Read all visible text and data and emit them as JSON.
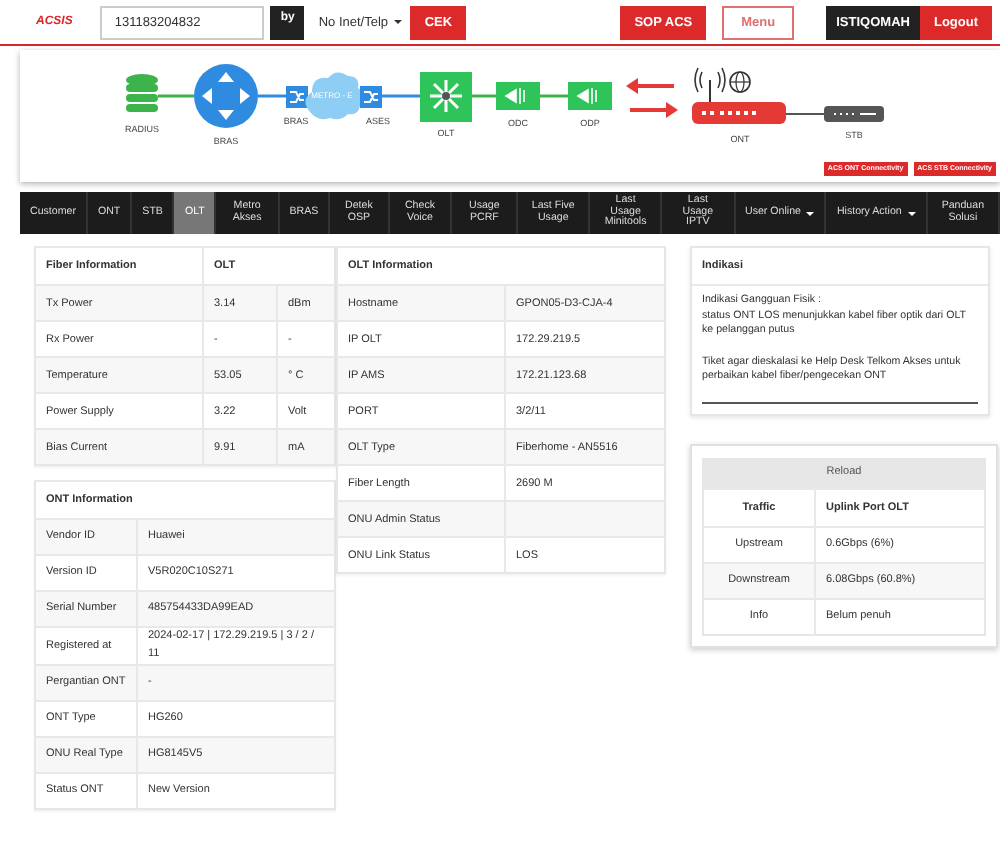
{
  "header": {
    "logo": "ACSIS",
    "search_value": "131183204832",
    "by_label": "by",
    "select_value": "No Inet/Telp",
    "check_button": "CEK",
    "sop_button": "SOP ACS",
    "menu_button": "Menu",
    "user": "ISTIQOMAH",
    "logout_button": "Logout"
  },
  "topology": {
    "nodes": [
      {
        "kind": "database",
        "label": "RADIUS"
      },
      {
        "kind": "router",
        "label": "BRAS"
      },
      {
        "kind": "metro",
        "label": "METRO - E",
        "left_label": "BRAS",
        "right_label": "ASES"
      },
      {
        "kind": "olt",
        "label": "OLT"
      },
      {
        "kind": "odc",
        "label": "ODC"
      },
      {
        "kind": "odp",
        "label": "ODP"
      },
      {
        "kind": "ont",
        "label": "ONT"
      },
      {
        "kind": "stb",
        "label": "STB"
      }
    ],
    "buttons": [
      "ACS ONT Connectivity",
      "ACS STB Connectivity"
    ]
  },
  "tabs": [
    {
      "label": "Customer",
      "selected": false,
      "dropdown": false
    },
    {
      "label": "ONT",
      "selected": false,
      "dropdown": false
    },
    {
      "label": "STB",
      "selected": false,
      "dropdown": false
    },
    {
      "label": "OLT",
      "selected": true,
      "dropdown": false
    },
    {
      "label": "Metro Akses",
      "selected": false,
      "dropdown": false
    },
    {
      "label": "BRAS",
      "selected": false,
      "dropdown": false
    },
    {
      "label": "Detek OSP",
      "selected": false,
      "dropdown": false
    },
    {
      "label": "Check Voice",
      "selected": false,
      "dropdown": false
    },
    {
      "label": "Usage PCRF",
      "selected": false,
      "dropdown": false
    },
    {
      "label": "Last Five Usage",
      "selected": false,
      "dropdown": false
    },
    {
      "label": "Last Usage Minitools",
      "selected": false,
      "dropdown": false
    },
    {
      "label": "Last Usage IPTV",
      "selected": false,
      "dropdown": false
    },
    {
      "label": "User Online",
      "selected": false,
      "dropdown": true
    },
    {
      "label": "History Action",
      "selected": false,
      "dropdown": true
    },
    {
      "label": "Panduan Solusi",
      "selected": false,
      "dropdown": false
    }
  ],
  "fiber_information": {
    "title": "Fiber Information",
    "column_2": "OLT",
    "rows": [
      {
        "label": "Tx Power",
        "value": "3.14",
        "unit": "dBm"
      },
      {
        "label": "Rx Power",
        "value": "-",
        "unit": "-"
      },
      {
        "label": "Temperature",
        "value": "53.05",
        "unit": "° C"
      },
      {
        "label": "Power Supply",
        "value": "3.22",
        "unit": "Volt"
      },
      {
        "label": "Bias Current",
        "value": "9.91",
        "unit": "mA"
      }
    ]
  },
  "ont_information": {
    "title": "ONT Information",
    "rows": [
      {
        "label": "Vendor ID",
        "value": "Huawei"
      },
      {
        "label": "Version ID",
        "value": "V5R020C10S271"
      },
      {
        "label": "Serial Number",
        "value": "485754433DA99EAD"
      },
      {
        "label": "Registered at",
        "value": "2024-02-17 | 172.29.219.5 | 3 / 2 / 11"
      },
      {
        "label": "Pergantian ONT",
        "value": "-"
      },
      {
        "label": "ONT Type",
        "value": "HG260"
      },
      {
        "label": "ONU Real Type",
        "value": "HG8145V5"
      },
      {
        "label": "Status ONT",
        "value": "New Version"
      }
    ]
  },
  "olt_information": {
    "title": "OLT Information",
    "rows": [
      {
        "label": "Hostname",
        "value": "GPON05-D3-CJA-4"
      },
      {
        "label": "IP OLT",
        "value": "172.29.219.5"
      },
      {
        "label": "IP AMS",
        "value": "172.21.123.68"
      },
      {
        "label": "PORT",
        "value": "3/2/11"
      },
      {
        "label": "OLT Type",
        "value": "Fiberhome - AN5516"
      },
      {
        "label": "Fiber Length",
        "value": "2690 M"
      },
      {
        "label": "ONU Admin Status"
      },
      {
        "label": "ONU Link Status",
        "value": "LOS"
      }
    ]
  },
  "indikasi": {
    "title": "Indikasi",
    "paragraphs": [
      "Indikasi Gangguan Fisik :\nstatus ONT LOS menunjukkan kabel fiber optik dari OLT ke pelanggan putus",
      "Tiket agar dieskalasi ke Help Desk Telkom Akses untuk perbaikan kabel fiber/pengecekan ONT"
    ]
  },
  "reload": {
    "button": "Reload",
    "columns": [
      "Traffic",
      "Uplink Port OLT"
    ],
    "rows": [
      {
        "label": "Upstream",
        "value": "0.6Gbps (6%)"
      },
      {
        "label": "Downstream",
        "value": "6.08Gbps (60.8%)"
      },
      {
        "label": "Info",
        "value": "Belum penuh"
      }
    ]
  }
}
